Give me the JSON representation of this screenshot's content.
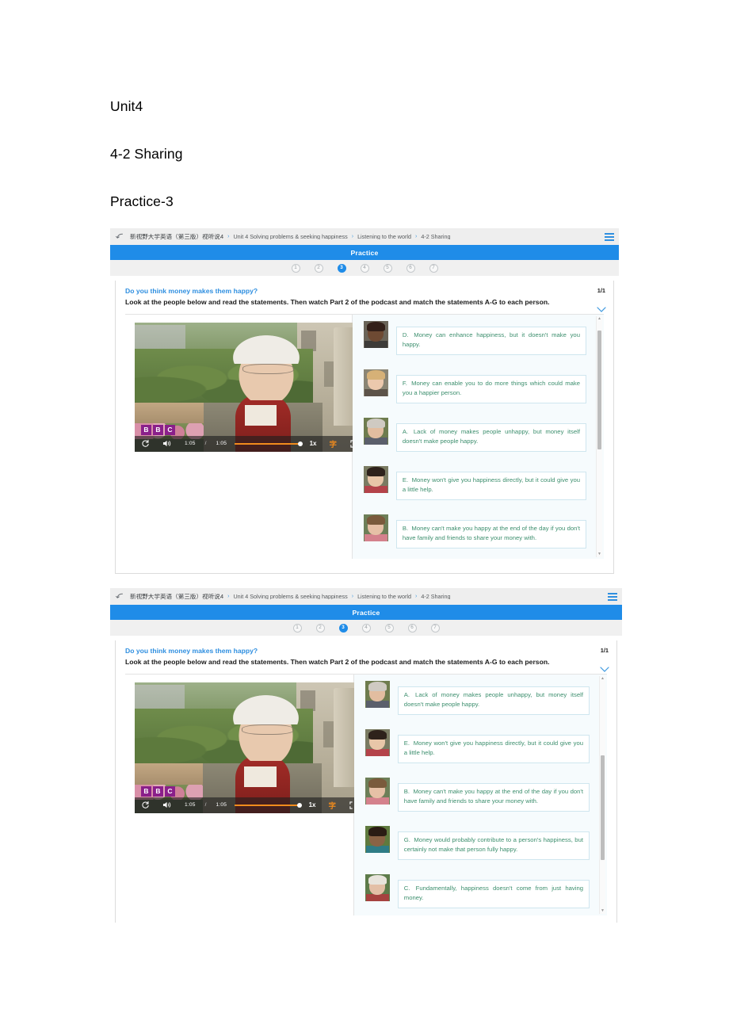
{
  "document": {
    "heading_unit": "Unit4",
    "heading_lesson": "4-2 Sharing",
    "heading_practice": "Practice-3"
  },
  "colors": {
    "brand_blue": "#1f8ce8",
    "link_blue": "#2f8fe0",
    "statement_green": "#3d8f6e",
    "player_orange": "#f08b1d",
    "bbc_purple": "#8a1f8a"
  },
  "app": {
    "breadcrumb": {
      "back_icon": "back-arrow-icon",
      "items": [
        "新视野大学英语（第三版）视听说4",
        "Unit 4 Solving problems & seeking happiness",
        "Listening to the world",
        "4-2 Sharing"
      ],
      "separator": "›",
      "menu_icon": "hamburger-menu-icon"
    },
    "section_title": "Practice",
    "steps": [
      "1",
      "2",
      "3",
      "4",
      "5",
      "6",
      "7"
    ],
    "active_step": "3",
    "question": {
      "title": "Do you think money makes them happy?",
      "instruction": "Look at the people below and read the statements. Then watch Part 2 of the podcast and match the statements A-G to each person.",
      "counter": "1/1",
      "collapse_icon": "chevron-down-icon"
    },
    "player": {
      "replay_icon": "replay-icon",
      "volume_icon": "volume-icon",
      "current_time": "1:05",
      "separator": "/",
      "duration": "1:05",
      "speed": "1x",
      "caption_icon": "字",
      "fullscreen_icon": "fullscreen-icon",
      "watermark": [
        "B",
        "B",
        "C"
      ]
    }
  },
  "screenshot_1": {
    "statements": [
      {
        "label": "D.",
        "text": "Money can enhance happiness, but it doesn't make you happy."
      },
      {
        "label": "F.",
        "text": "Money can enable you to do more things which could make you a happier person."
      },
      {
        "label": "A.",
        "text": "Lack of money makes people unhappy, but money itself doesn't make people happy."
      },
      {
        "label": "E.",
        "text": "Money won't give you happiness directly, but it could give you a little help."
      },
      {
        "label": "B.",
        "text": "Money can't make you happy at the end of the day if you don't have family and friends to share your money with."
      }
    ]
  },
  "screenshot_2": {
    "statements": [
      {
        "label": "A.",
        "text": "Lack of money makes people unhappy, but money itself doesn't make people happy."
      },
      {
        "label": "E.",
        "text": "Money won't give you happiness directly, but it could give you a little help."
      },
      {
        "label": "B.",
        "text": "Money can't make you happy at the end of the day if you don't have family and friends to share your money with."
      },
      {
        "label": "G.",
        "text": "Money would probably contribute to a person's happiness, but certainly not make that person fully happy."
      },
      {
        "label": "C.",
        "text": "Fundamentally, happiness doesn't come from just having money."
      }
    ]
  }
}
